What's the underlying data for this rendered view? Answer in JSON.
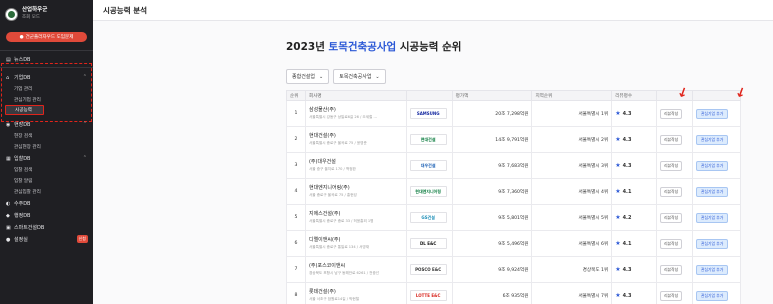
{
  "sidebar": {
    "brand_title": "산업하우군",
    "brand_sub": "조회 모드",
    "guide_button": "건군플러자우드 도임문제",
    "items": [
      {
        "label": "뉴스DB"
      },
      {
        "label": "기업DB"
      },
      {
        "label": "현장DB"
      },
      {
        "label": "입찰DB"
      },
      {
        "label": "수주DB"
      },
      {
        "label": "행정DB"
      },
      {
        "label": "스마트건설DB"
      },
      {
        "label": "설정실",
        "badge": "신청"
      }
    ],
    "sub_company": [
      "기업 관리",
      "관심기업 관리",
      "시공능력"
    ],
    "sub_site": [
      "현장 검색",
      "관심현장 관리"
    ],
    "sub_bid": [
      "입찰 검색",
      "입찰 알림",
      "관심입찰 관리"
    ]
  },
  "header": {
    "title": "시공능력 분석"
  },
  "main": {
    "title_prefix": "2023년",
    "title_accent": "토목건축공사업",
    "title_suffix": "시공능력 순위",
    "filter1": "종합건설업",
    "filter2": "토목건축공사업",
    "columns": [
      "순위",
      "회사명",
      "",
      "평가액",
      "지역순위",
      "리뷰평수",
      "",
      ""
    ],
    "rows": [
      {
        "rank": "1",
        "name": "삼성물산(주)",
        "addr": "서울특별시 강동구 상일로6길 26 / 오세철 ...",
        "logo": "SAMSUNG",
        "logo_color": "#1428a0",
        "amount": "20조 7,298억원",
        "region": "서울특별시 1위",
        "rating": "4.3"
      },
      {
        "rank": "2",
        "name": "현대건설(주)",
        "addr": "서울특별시 종로구 율곡로 75 / 윤영준",
        "logo": "현대건설",
        "logo_color": "#0a7b3e",
        "amount": "14조 9,791억원",
        "region": "서울특별시 2위",
        "rating": "4.3"
      },
      {
        "rank": "3",
        "name": "(주)대우건설",
        "addr": "서울 중구 을지로 170 / 백정완",
        "logo": "대우건설",
        "logo_color": "#1a5fb4",
        "amount": "9조 7,683억원",
        "region": "서울특별시 3위",
        "rating": "4.3"
      },
      {
        "rank": "4",
        "name": "현대엔지니어링(주)",
        "addr": "서울 종로구 율곡로 75 / 홍현성",
        "logo": "현대엔지니어링",
        "logo_color": "#0a7b3e",
        "amount": "9조 7,360억원",
        "region": "서울특별시 4위",
        "rating": "4.1"
      },
      {
        "rank": "5",
        "name": "지에스건설(주)",
        "addr": "서울특별시 종로구 종로 33 / 허윤홍외 1명",
        "logo": "GS건설",
        "logo_color": "#1f8fb8",
        "amount": "9조 5,801억원",
        "region": "서울특별시 5위",
        "rating": "4.2"
      },
      {
        "rank": "6",
        "name": "디엘이앤씨(주)",
        "addr": "서울특별시 종로구 통일로 134 / 서영재",
        "logo": "DL E&C",
        "logo_color": "#111111",
        "amount": "9조 5,496억원",
        "region": "서울특별시 6위",
        "rating": "4.1"
      },
      {
        "rank": "7",
        "name": "(주)포스코이앤씨",
        "addr": "경상북도 포항시 남구 동해안로 6261 / 전중선",
        "logo": "POSCO E&C",
        "logo_color": "#333333",
        "amount": "9조 9,924억원",
        "region": "경상북도 1위",
        "rating": "4.3"
      },
      {
        "rank": "8",
        "name": "롯데건설(주)",
        "addr": "서울 서초구 잠원로14길 / 박현철",
        "logo": "LOTTE E&C",
        "logo_color": "#d8251d",
        "amount": "6조 935억원",
        "region": "서울특별시 7위",
        "rating": "4.3"
      }
    ],
    "review_btn": "리뷰작성",
    "add_btn": "관심기업 추가"
  }
}
